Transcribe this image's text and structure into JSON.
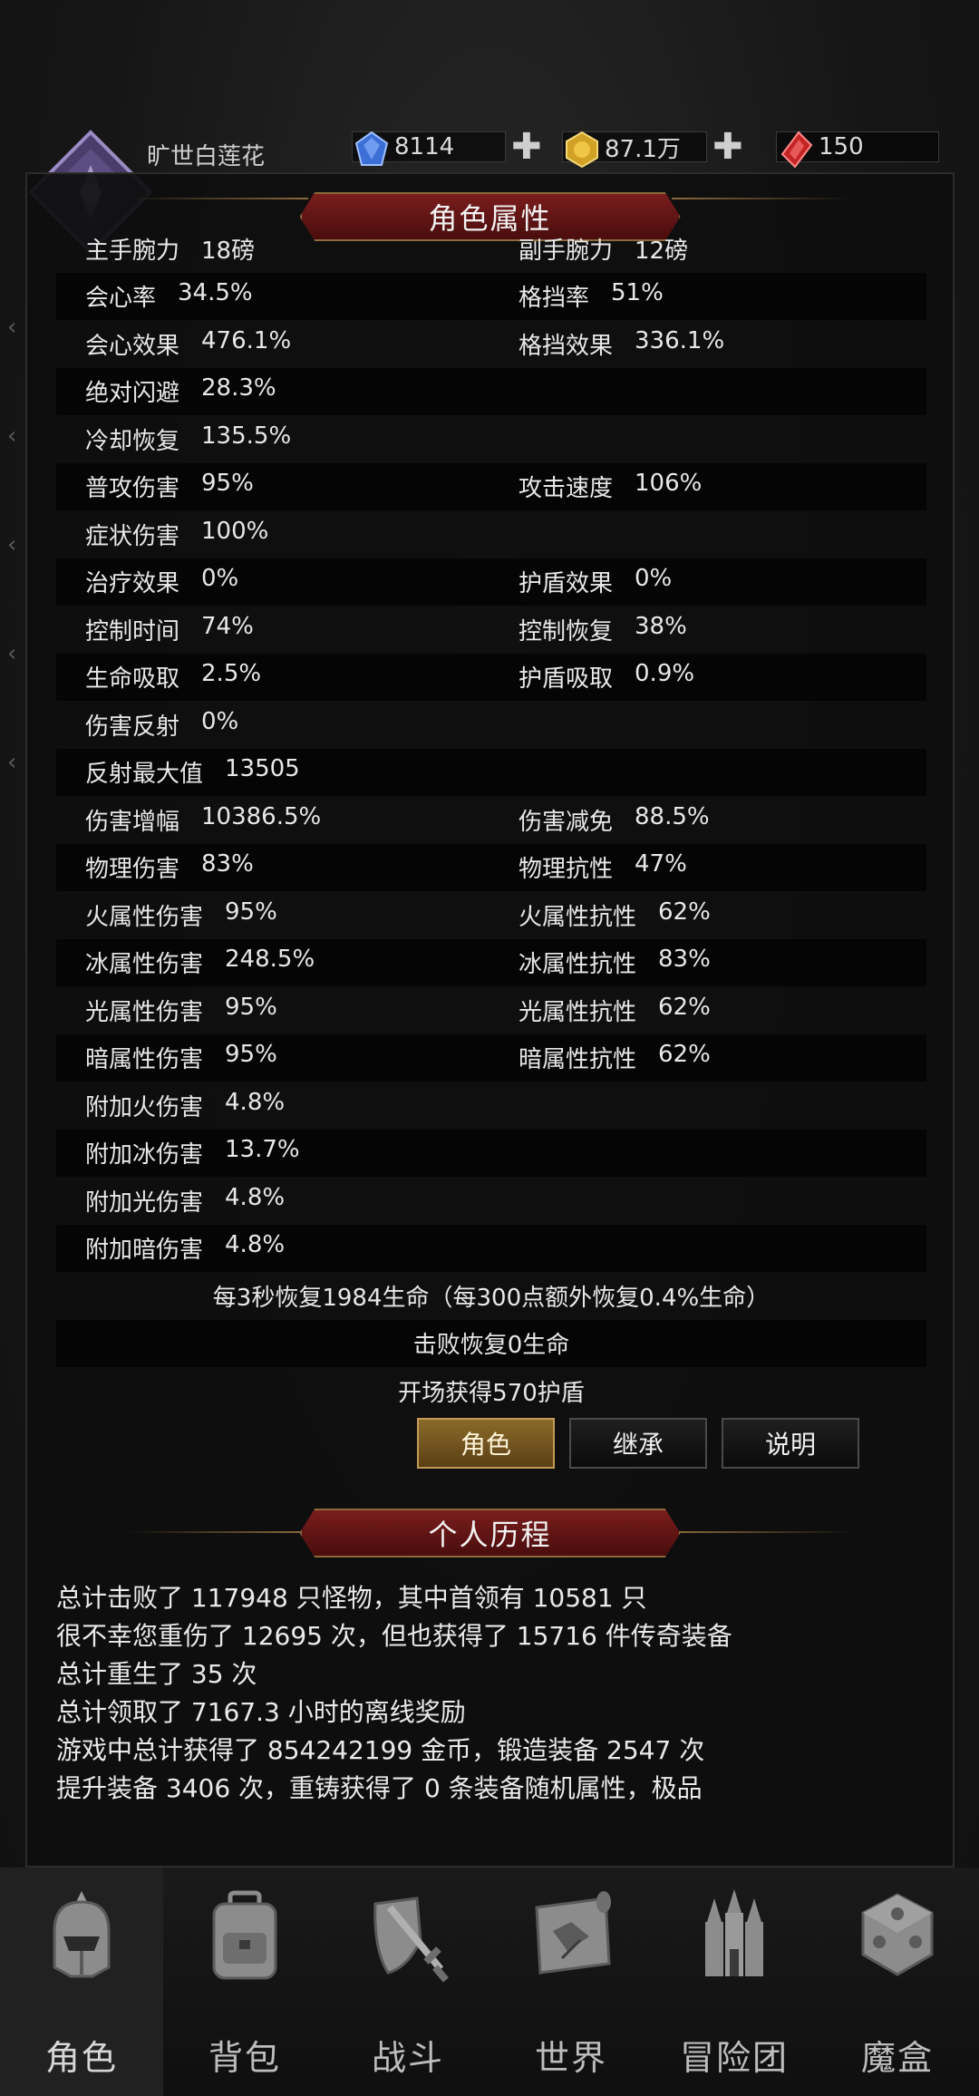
{
  "header": {
    "player_name": "旷世白莲花",
    "currencies": [
      {
        "icon": "blue-gem-icon",
        "value": "8114",
        "color": "#3b6fd6"
      },
      {
        "icon": "gold-coin-icon",
        "value": "87.1万",
        "color": "#d1a125"
      },
      {
        "icon": "red-crystal-icon",
        "value": "150",
        "color": "#c32424"
      }
    ],
    "add_symbol": "✚"
  },
  "panel": {
    "title": "角色属性",
    "rows": [
      {
        "dark": false,
        "left": {
          "label": "主手腕力",
          "value": "18磅"
        },
        "right": {
          "label": "副手腕力",
          "value": "12磅"
        }
      },
      {
        "dark": true,
        "left": {
          "label": "会心率",
          "value": "34.5%"
        },
        "right": {
          "label": "格挡率",
          "value": "51%"
        }
      },
      {
        "dark": false,
        "left": {
          "label": "会心效果",
          "value": "476.1%"
        },
        "right": {
          "label": "格挡效果",
          "value": "336.1%"
        }
      },
      {
        "dark": true,
        "left": {
          "label": "绝对闪避",
          "value": "28.3%"
        },
        "right": null
      },
      {
        "dark": false,
        "left": {
          "label": "冷却恢复",
          "value": "135.5%"
        },
        "right": null
      },
      {
        "dark": true,
        "left": {
          "label": "普攻伤害",
          "value": "95%"
        },
        "right": {
          "label": "攻击速度",
          "value": "106%"
        }
      },
      {
        "dark": false,
        "left": {
          "label": "症状伤害",
          "value": "100%"
        },
        "right": null
      },
      {
        "dark": true,
        "left": {
          "label": "治疗效果",
          "value": "0%"
        },
        "right": {
          "label": "护盾效果",
          "value": "0%"
        }
      },
      {
        "dark": false,
        "left": {
          "label": "控制时间",
          "value": "74%"
        },
        "right": {
          "label": "控制恢复",
          "value": "38%"
        }
      },
      {
        "dark": true,
        "left": {
          "label": "生命吸取",
          "value": "2.5%"
        },
        "right": {
          "label": "护盾吸取",
          "value": "0.9%"
        }
      },
      {
        "dark": false,
        "left": {
          "label": "伤害反射",
          "value": "0%"
        },
        "right": null
      },
      {
        "dark": true,
        "left": {
          "label": "反射最大值",
          "value": "13505"
        },
        "right": null
      },
      {
        "dark": false,
        "left": {
          "label": "伤害增幅",
          "value": "10386.5%"
        },
        "right": {
          "label": "伤害减免",
          "value": "88.5%"
        }
      },
      {
        "dark": true,
        "left": {
          "label": "物理伤害",
          "value": "83%"
        },
        "right": {
          "label": "物理抗性",
          "value": "47%"
        }
      },
      {
        "dark": false,
        "left": {
          "label": "火属性伤害",
          "value": "95%"
        },
        "right": {
          "label": "火属性抗性",
          "value": "62%"
        }
      },
      {
        "dark": true,
        "left": {
          "label": "冰属性伤害",
          "value": "248.5%"
        },
        "right": {
          "label": "冰属性抗性",
          "value": "83%"
        }
      },
      {
        "dark": false,
        "left": {
          "label": "光属性伤害",
          "value": "95%"
        },
        "right": {
          "label": "光属性抗性",
          "value": "62%"
        }
      },
      {
        "dark": true,
        "left": {
          "label": "暗属性伤害",
          "value": "95%"
        },
        "right": {
          "label": "暗属性抗性",
          "value": "62%"
        }
      },
      {
        "dark": false,
        "left": {
          "label": "附加火伤害",
          "value": "4.8%"
        },
        "right": null
      },
      {
        "dark": true,
        "left": {
          "label": "附加冰伤害",
          "value": "13.7%"
        },
        "right": null
      },
      {
        "dark": false,
        "left": {
          "label": "附加光伤害",
          "value": "4.8%"
        },
        "right": null
      },
      {
        "dark": true,
        "left": {
          "label": "附加暗伤害",
          "value": "4.8%"
        },
        "right": null
      }
    ],
    "regen_line": "每3秒恢复1984生命（每300点额外恢复0.4%生命）",
    "defeat_line": "击败恢复0生命",
    "shield_line": "开场获得570护盾",
    "buttons": [
      "角色",
      "继承",
      "说明"
    ],
    "history_title": "个人历程",
    "history_lines": [
      "总计击败了 117948 只怪物，其中首领有 10581 只",
      "很不幸您重伤了 12695 次，但也获得了 15716 件传奇装备",
      "总计重生了 35 次",
      "总计领取了 7167.3 小时的离线奖励",
      "游戏中总计获得了 854242199 金币，锻造装备 2547 次",
      "提升装备 3406 次，重铸获得了 0 条装备随机属性，极品"
    ]
  },
  "nav": [
    {
      "label": "角色",
      "icon": "knight-helmet-icon",
      "active": true
    },
    {
      "label": "背包",
      "icon": "backpack-icon",
      "active": false
    },
    {
      "label": "战斗",
      "icon": "shield-sword-icon",
      "active": false
    },
    {
      "label": "世界",
      "icon": "map-scroll-icon",
      "active": false
    },
    {
      "label": "冒险团",
      "icon": "castle-icon",
      "active": false
    },
    {
      "label": "魔盒",
      "icon": "magic-cube-icon",
      "active": false
    }
  ]
}
